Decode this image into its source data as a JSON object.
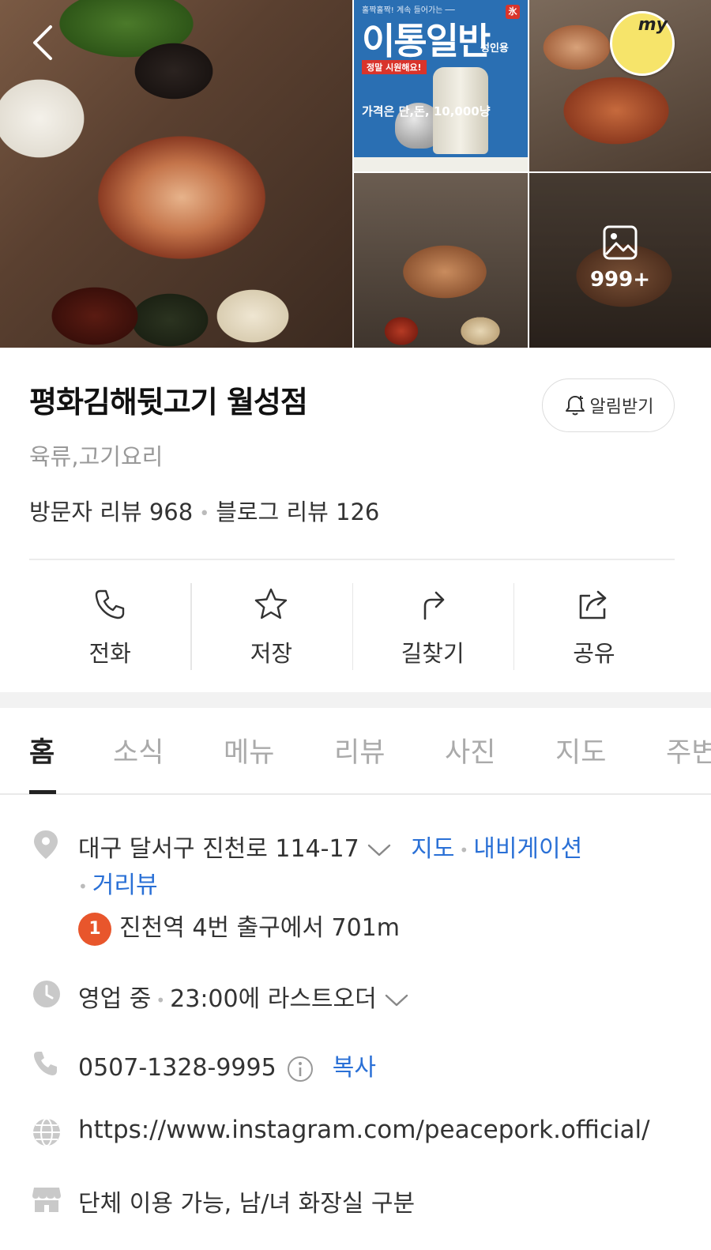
{
  "photos": {
    "poster": {
      "top_text": "홀짝홀짝! 계속 들어가는 ──",
      "title": "이통일반",
      "ice_badge": "氷",
      "red_label": "정말 시원해요!",
      "subtitle": "성인용",
      "price": "가격은 단,돈, 10,000냥"
    },
    "badge_text": "my",
    "count": "999+"
  },
  "place": {
    "name": "평화김해뒷고기 월성점",
    "category": "육류,고기요리",
    "visitor_reviews": "방문자 리뷰 968",
    "blog_reviews": "블로그 리뷰 126",
    "alert_label": "알림받기"
  },
  "actions": [
    {
      "label": "전화",
      "icon": "phone-icon"
    },
    {
      "label": "저장",
      "icon": "star-icon"
    },
    {
      "label": "길찾기",
      "icon": "directions-icon"
    },
    {
      "label": "공유",
      "icon": "share-icon"
    }
  ],
  "tabs": [
    "홈",
    "소식",
    "메뉴",
    "리뷰",
    "사진",
    "지도",
    "주변"
  ],
  "active_tab": "홈",
  "info": {
    "address": "대구 달서구 진천로 114-17",
    "map_link": "지도",
    "nav_link": "내비게이션",
    "street_view": "거리뷰",
    "subway_line": "1",
    "subway_text": "진천역 4번 출구에서 701m",
    "hours_status": "영업 중",
    "hours_text": "23:00에 라스트오더",
    "phone": "0507-1328-9995",
    "copy_label": "복사",
    "website": "https://www.instagram.com/peacepork.official/",
    "facilities": "단체 이용 가능, 남/녀 화장실 구분"
  },
  "colors": {
    "link_blue": "#2a70d6",
    "subway_orange": "#e8562c",
    "poster_blue": "#2a6fb3"
  }
}
